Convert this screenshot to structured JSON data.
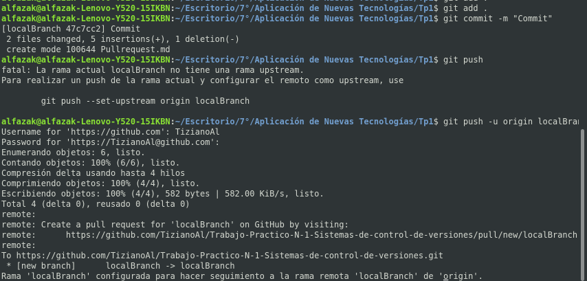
{
  "terminal": {
    "colors": {
      "background": "#2e3436",
      "text": "#d3d7cf",
      "user_host": "#8ae234",
      "path": "#729fcf"
    },
    "lines": [
      {
        "type": "prompt",
        "user": "alfazak@alfazak-Lenovo-Y520-15IKBN",
        "sep": ":",
        "path": "~/Escritorio/7°/Aplicación de Nuevas Tecnologías/Tp1",
        "cmd": "$ git add ."
      },
      {
        "type": "prompt",
        "user": "alfazak@alfazak-Lenovo-Y520-15IKBN",
        "sep": ":",
        "path": "~/Escritorio/7°/Aplicación de Nuevas Tecnologías/Tp1",
        "cmd": "$ git add ."
      },
      {
        "type": "prompt",
        "user": "alfazak@alfazak-Lenovo-Y520-15IKBN",
        "sep": ":",
        "path": "~/Escritorio/7°/Aplicación de Nuevas Tecnologías/Tp1",
        "cmd": "$ git commit -m \"Commit\""
      },
      {
        "type": "output",
        "text": "[localBranch 47c7cc2] Commit"
      },
      {
        "type": "output",
        "text": " 2 files changed, 5 insertions(+), 1 deletion(-)"
      },
      {
        "type": "output",
        "text": " create mode 100644 Pullrequest.md"
      },
      {
        "type": "prompt",
        "user": "alfazak@alfazak-Lenovo-Y520-15IKBN",
        "sep": ":",
        "path": "~/Escritorio/7°/Aplicación de Nuevas Tecnologías/Tp1",
        "cmd": "$ git push"
      },
      {
        "type": "output",
        "text": "fatal: La rama actual localBranch no tiene una rama upstream."
      },
      {
        "type": "output",
        "text": "Para realizar un push de la rama actual y configurar el remoto como upstream, use"
      },
      {
        "type": "output",
        "text": ""
      },
      {
        "type": "output",
        "text": "        git push --set-upstream origin localBranch"
      },
      {
        "type": "output",
        "text": ""
      },
      {
        "type": "prompt",
        "user": "alfazak@alfazak-Lenovo-Y520-15IKBN",
        "sep": ":",
        "path": "~/Escritorio/7°/Aplicación de Nuevas Tecnologías/Tp1",
        "cmd": "$ git push -u origin localBranch"
      },
      {
        "type": "output",
        "text": "Username for 'https://github.com': TizianoAl"
      },
      {
        "type": "output",
        "text": "Password for 'https://TizianoAl@github.com':"
      },
      {
        "type": "output",
        "text": "Enumerando objetos: 6, listo."
      },
      {
        "type": "output",
        "text": "Contando objetos: 100% (6/6), listo."
      },
      {
        "type": "output",
        "text": "Compresión delta usando hasta 4 hilos"
      },
      {
        "type": "output",
        "text": "Comprimiendo objetos: 100% (4/4), listo."
      },
      {
        "type": "output",
        "text": "Escribiendo objetos: 100% (4/4), 582 bytes | 582.00 KiB/s, listo."
      },
      {
        "type": "output",
        "text": "Total 4 (delta 0), reusado 0 (delta 0)"
      },
      {
        "type": "output",
        "text": "remote:"
      },
      {
        "type": "output",
        "text": "remote: Create a pull request for 'localBranch' on GitHub by visiting:"
      },
      {
        "type": "output",
        "text": "remote:      https://github.com/TizianoAl/Trabajo-Practico-N-1-Sistemas-de-control-de-versiones/pull/new/localBranch"
      },
      {
        "type": "output",
        "text": "remote:"
      },
      {
        "type": "output",
        "text": "To https://github.com/TizianoAl/Trabajo-Practico-N-1-Sistemas-de-control-de-versiones.git"
      },
      {
        "type": "output",
        "text": " * [new branch]      localBranch -> localBranch"
      },
      {
        "type": "cursor",
        "before": "Rama 'localBranch' configurada para hacer seguimiento a la rama remota 'localBranch' de '",
        "cursor_char": "o",
        "after": "rigin'."
      }
    ]
  }
}
